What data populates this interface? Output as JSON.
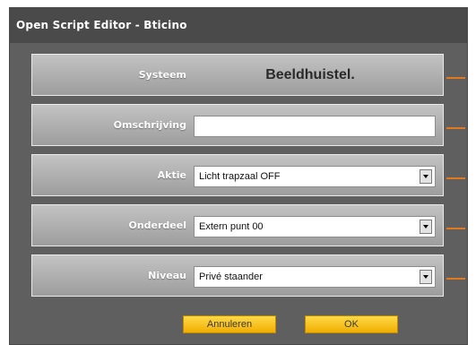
{
  "window": {
    "title": "Open Script Editor - Bticino"
  },
  "form": {
    "system": {
      "label": "Systeem",
      "value": "Beeldhuistel."
    },
    "description": {
      "label": "Omschrijving",
      "value": ""
    },
    "action": {
      "label": "Aktie",
      "value": "Licht trapzaal OFF"
    },
    "component": {
      "label": "Onderdeel",
      "value": "Extern punt 00"
    },
    "level": {
      "label": "Niveau",
      "value": "Privé staander"
    }
  },
  "buttons": {
    "cancel": "Annuleren",
    "ok": "OK"
  },
  "colors": {
    "callout": "#e07a1f",
    "button": "#f6be1a",
    "panel": "#5f5f5f",
    "row": "#b0b0b0"
  }
}
